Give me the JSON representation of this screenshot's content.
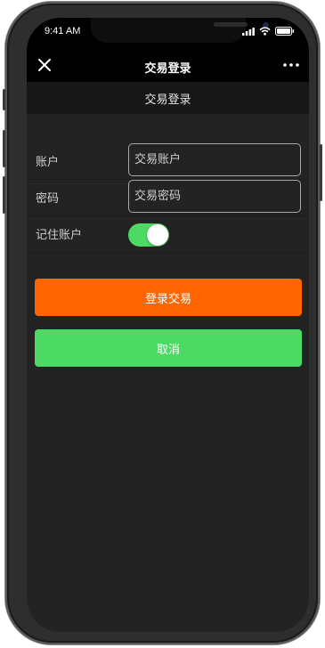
{
  "status_bar": {
    "time": "9:41 AM"
  },
  "nav": {
    "title": "交易登录"
  },
  "page": {
    "header_title": "交易登录"
  },
  "form": {
    "account": {
      "label": "账户",
      "placeholder": "交易账户"
    },
    "password": {
      "label": "密码",
      "placeholder": "交易密码"
    },
    "remember": {
      "label": "记住账户",
      "enabled": true
    }
  },
  "buttons": {
    "login": "登录交易",
    "cancel": "取消"
  },
  "colors": {
    "login_button": "#ff6600",
    "cancel_button": "#4cd964",
    "toggle_on": "#4cd964",
    "background": "#232323"
  },
  "icons": {
    "nav_left": "close-icon",
    "nav_right": "more-icon",
    "status": [
      "signal-icon",
      "wifi-icon",
      "battery-icon"
    ]
  }
}
